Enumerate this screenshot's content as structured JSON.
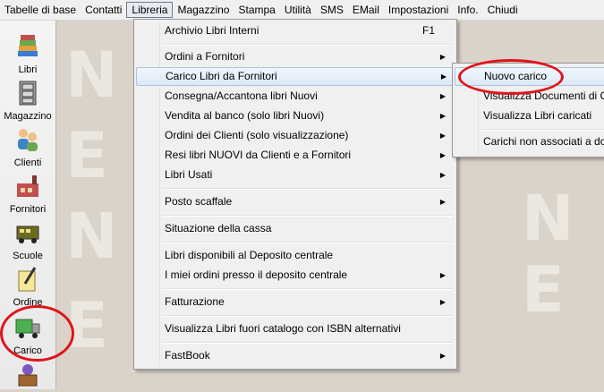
{
  "menubar": {
    "items": [
      "Tabelle di base",
      "Contatti",
      "Libreria",
      "Magazzino",
      "Stampa",
      "Utilità",
      "SMS",
      "EMail",
      "Impostazioni",
      "Info.",
      "Chiudi"
    ]
  },
  "sidebar": {
    "tools": [
      {
        "label": "Libri",
        "icon": "books-icon"
      },
      {
        "label": "Magazzino",
        "icon": "cabinet-icon"
      },
      {
        "label": "Clienti",
        "icon": "people-icon"
      },
      {
        "label": "Fornitori",
        "icon": "factory-icon"
      },
      {
        "label": "Scuole",
        "icon": "school-bus-icon"
      },
      {
        "label": "Ordine",
        "icon": "order-pen-icon"
      },
      {
        "label": "Carico",
        "icon": "truck-icon"
      },
      {
        "label": "",
        "icon": "crate-icon"
      }
    ]
  },
  "menu": {
    "archivio": "Archivio Libri Interni",
    "archivio_shortcut": "F1",
    "ordini_fornitori": "Ordini a Fornitori",
    "carico_fornitori": "Carico Libri da Fornitori",
    "consegna": "Consegna/Accantona libri Nuovi",
    "vendita": "Vendita al banco (solo libri Nuovi)",
    "ordini_clienti": "Ordini dei Clienti (solo visualizzazione)",
    "resi": "Resi libri NUOVI da Clienti e a Fornitori",
    "usati": "Libri Usati",
    "posto": "Posto scaffale",
    "cassa": "Situazione della cassa",
    "disponibili": "Libri disponibili al Deposito centrale",
    "miei_ordini": "I miei ordini presso il deposito centrale",
    "fatturazione": "Fatturazione",
    "fuori_catalogo": "Visualizza Libri fuori catalogo con ISBN alternativi",
    "fastbook": "FastBook"
  },
  "submenu": {
    "nuovo": "Nuovo carico",
    "documenti": "Visualizza Documenti di Ca",
    "caricati": "Visualizza Libri caricati",
    "non_associati": "Carichi non associati a doc"
  }
}
